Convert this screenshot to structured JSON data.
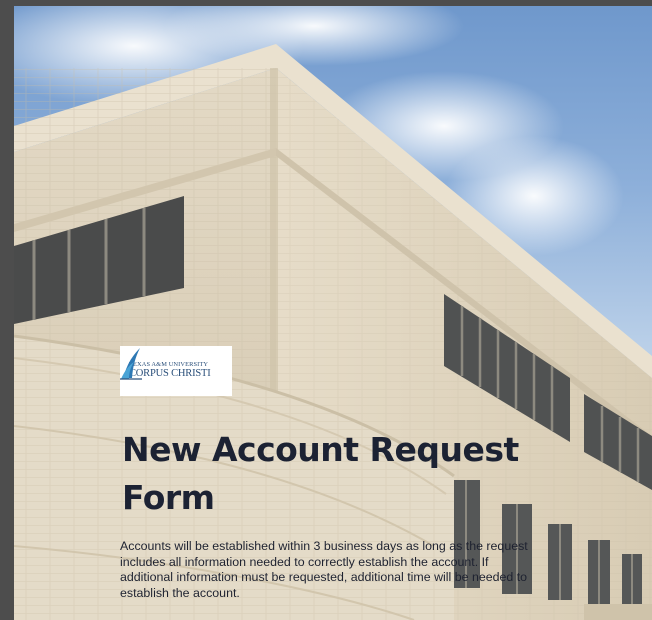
{
  "logo": {
    "line1": "TEXAS A&M UNIVERSITY",
    "line2": "CORPUS CHRISTI"
  },
  "form": {
    "title": "New Account Request Form",
    "description": "Accounts will be established within 3 business days as long as the request includes all information needed to correctly establish the account. If additional information must be requested, additional time will be needed to establish the account."
  },
  "colors": {
    "title": "#1c2233",
    "logo_text": "#2a4f7a",
    "sky": "#8eb0da",
    "building": "#ddd3bf"
  },
  "icons": {
    "logo_mark": "wing-icon"
  }
}
